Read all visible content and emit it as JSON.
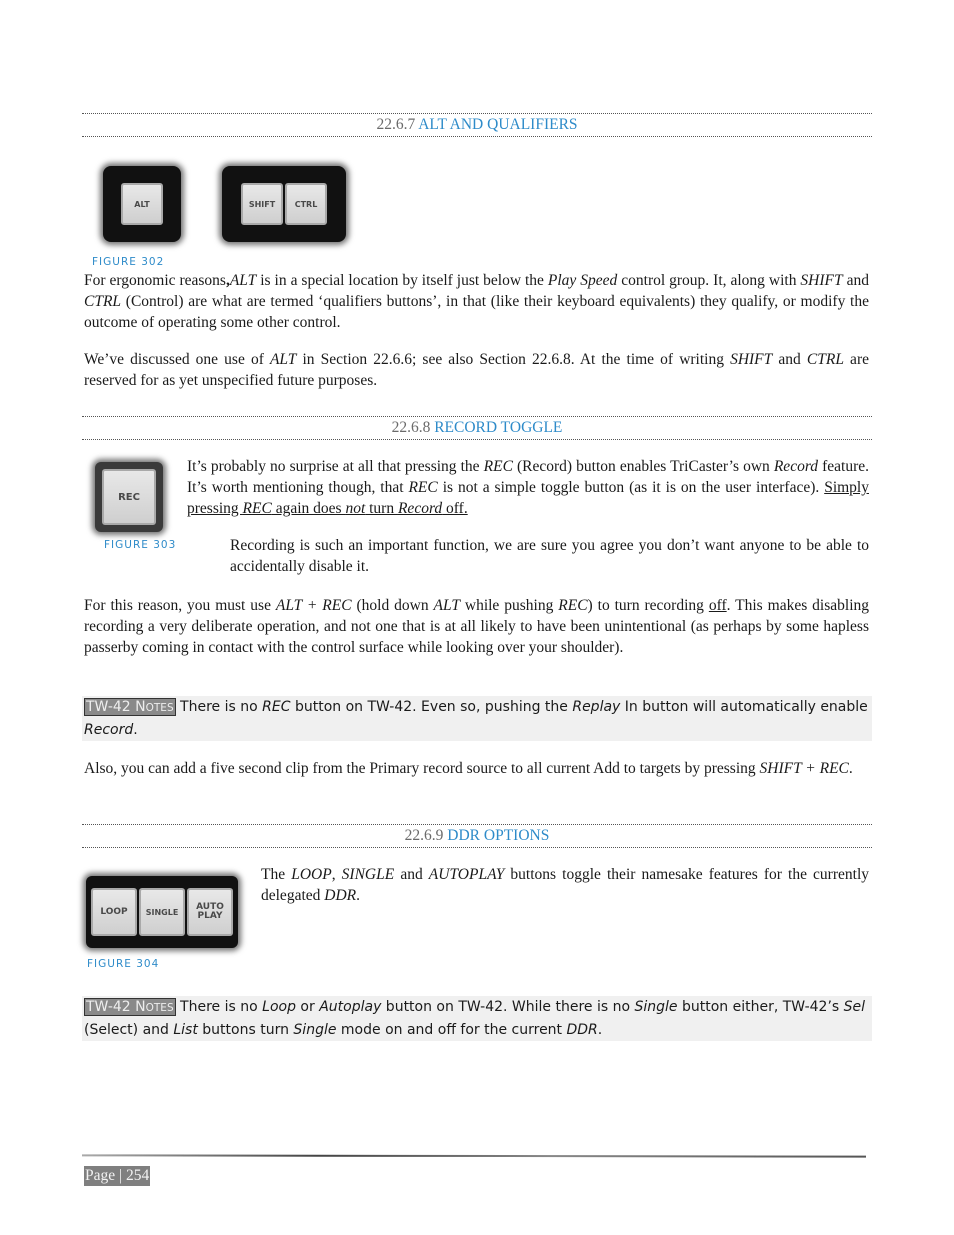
{
  "sections": [
    {
      "number": "22.6.7",
      "title": "ALT AND QUALIFIERS"
    },
    {
      "number": "22.6.8",
      "title": "RECORD TOGGLE"
    },
    {
      "number": "22.6.9",
      "title": "DDR OPTIONS"
    }
  ],
  "figures": {
    "fig302": {
      "caption": "FIGURE 302",
      "keys_left": [
        "ALT"
      ],
      "keys_right": [
        "SHIFT",
        "CTRL"
      ]
    },
    "fig303": {
      "caption": "FIGURE 303",
      "keys": [
        "REC"
      ]
    },
    "fig304": {
      "caption": "FIGURE 304",
      "keys": [
        "LOOP",
        "SINGLE",
        "AUTO PLAY"
      ]
    }
  },
  "s1": {
    "p1": {
      "a": "For ergonomic reasons",
      "b": ",",
      "c": "ALT",
      "d": " is in a special location by itself just below the ",
      "e": "Play Speed",
      "f": " control group.  It, along with ",
      "g": "SHIFT",
      "h": " and ",
      "i": "CTRL",
      "j": " (Control) are what are termed ‘qualifiers buttons’, in that (like their keyboard equivalents) they qualify, or modify the outcome of operating some other control."
    },
    "p2": {
      "a": "We’ve discussed one use of ",
      "b": "ALT",
      "c": " in Section 22.6.6; see also Section 22.6.8.  At the time of writing ",
      "d": "SHIFT",
      "e": " and ",
      "f": "CTRL",
      "g": " are reserved for as yet unspecified future purposes."
    }
  },
  "s2": {
    "p1": {
      "a": "It’s probably no surprise at all that pressing the ",
      "b": "REC",
      "c": " (Record) button enables TriCaster’s own ",
      "d": "Record",
      "e": " feature. It’s worth mentioning though, that ",
      "f": "REC",
      "g": " is not a simple toggle button (as it is on the user interface).  ",
      "h": "Simply pressing ",
      "i": "REC",
      "j": " again does ",
      "k": "not",
      "l": " turn ",
      "m": "Record",
      "n": " off."
    },
    "p2": "Recording is such an important function, we are sure you agree you don’t want anyone to be able to accidentally disable it.",
    "p3": {
      "a": "For this reason, you must use ",
      "b": "ALT + REC",
      "c": " (hold down ",
      "d": "ALT",
      "e": " while pushing ",
      "f": "REC",
      "g": ") to turn recording ",
      "h": "off",
      "i": ".  This makes disabling recording a very deliberate operation, and not one that is at all likely to have been unintentional (as perhaps by some hapless passerby coming in contact with the control surface while looking over your shoulder)."
    },
    "note": {
      "tag_a": "TW-42 N",
      "tag_b": "OTES",
      "a": " There is no ",
      "b": "REC",
      "c": " button on TW-42.  Even so, pushing the ",
      "d": "Replay",
      "e": " In button will automatically enable ",
      "f": "Record",
      "g": "."
    },
    "p4": {
      "a": "Also, you can add a five second clip from the Primary record source to all current Add to targets by pressing ",
      "b": "SHIFT + REC",
      "c": "."
    }
  },
  "s3": {
    "p1": {
      "a": "The ",
      "b": "LOOP",
      "c": ", ",
      "d": "SINGLE",
      "e": " and ",
      "f": "AUTOPLAY",
      "g": " buttons toggle their namesake features for the currently delegated ",
      "h": "DDR",
      "i": "."
    },
    "note": {
      "tag_a": "TW-42 N",
      "tag_b": "OTES",
      "a": " There is no ",
      "b": "Loop",
      "c": " or ",
      "d": "Autoplay",
      "e": " button on TW-42.  While there is no ",
      "f": "Single",
      "g": " button either, TW-42’s ",
      "h": "Sel",
      "i": " (Select) and ",
      "j": "List",
      "k": " buttons turn ",
      "l": "Single",
      "m": " mode on and off for the current ",
      "n": "DDR",
      "o": "."
    }
  },
  "footer": {
    "page_label": "Page | 254"
  }
}
